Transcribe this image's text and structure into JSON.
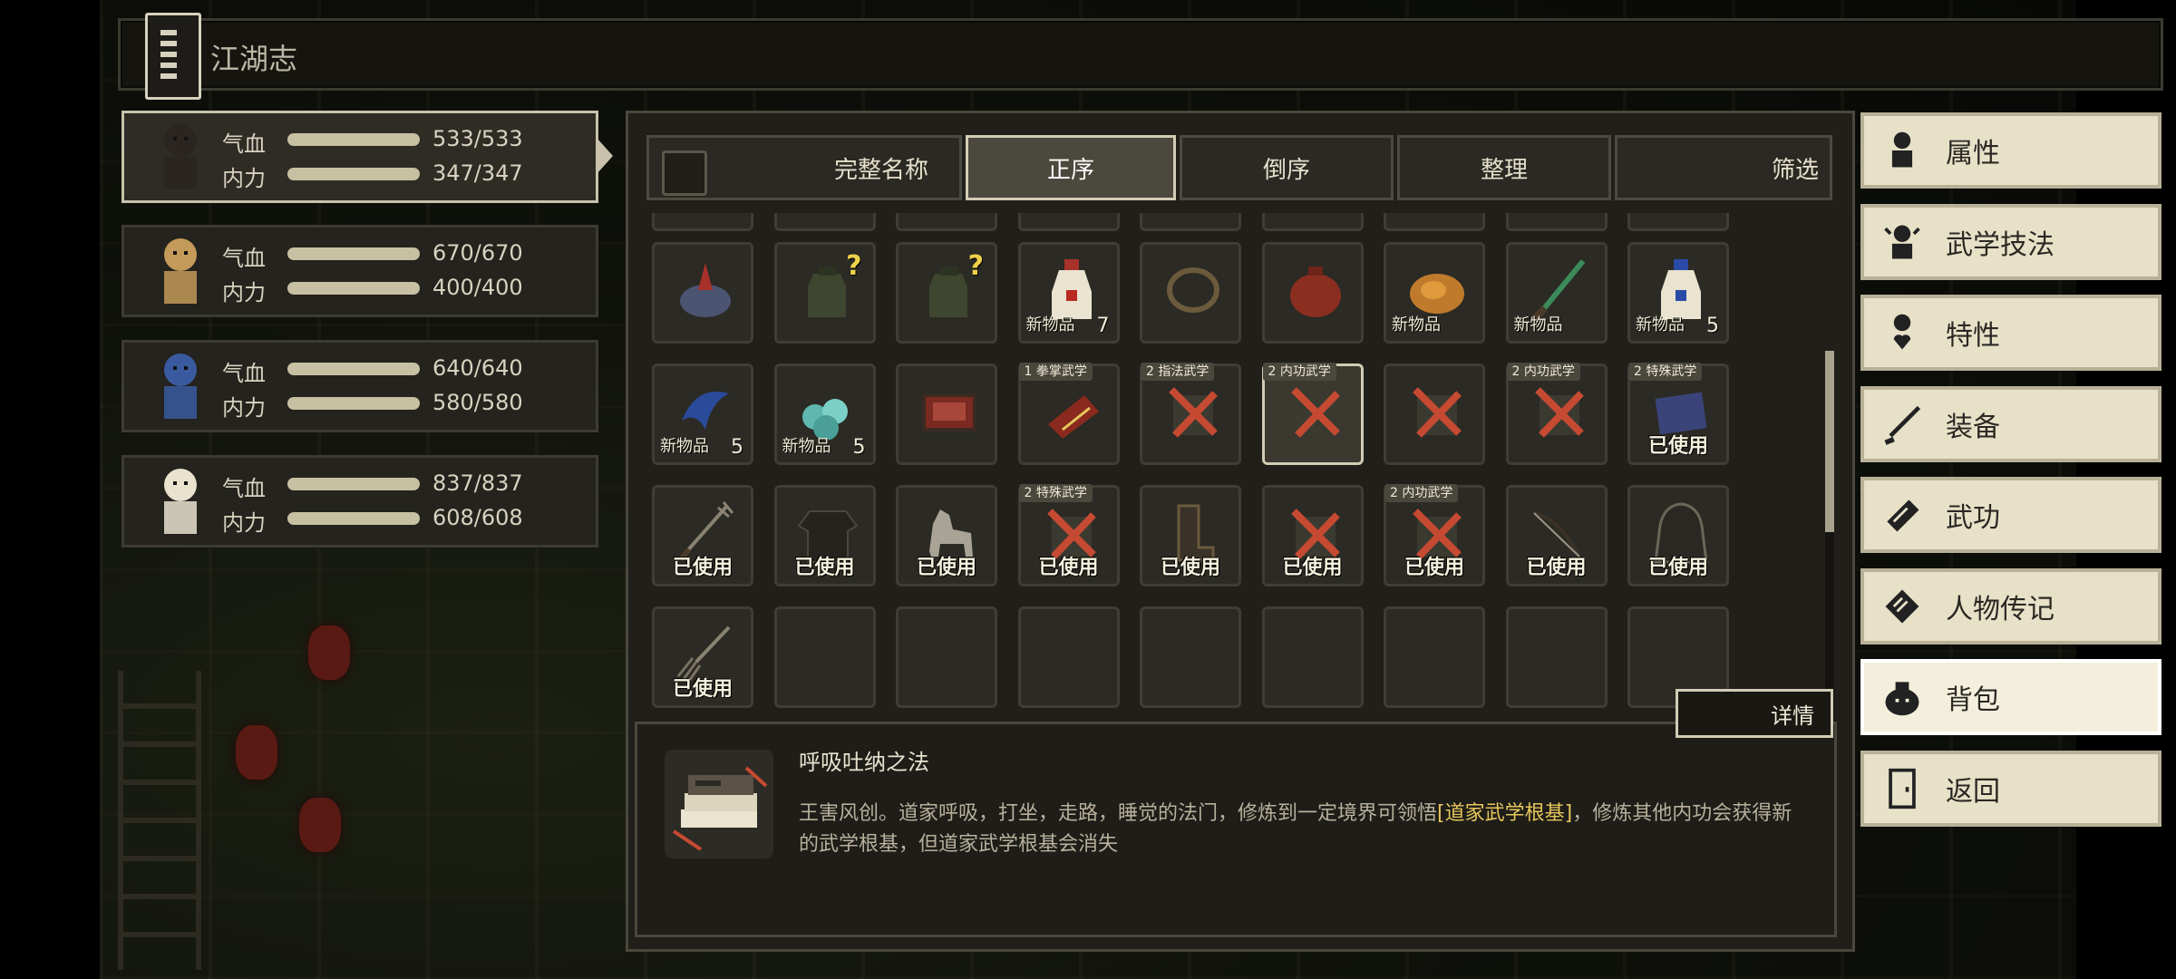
{
  "title": "江湖志",
  "party": [
    {
      "hp_label": "气血",
      "hp": "533/533",
      "mp_label": "内力",
      "mp": "347/347",
      "hp_fraction": 1,
      "mp_fraction": 1
    },
    {
      "hp_label": "气血",
      "hp": "670/670",
      "mp_label": "内力",
      "mp": "400/400",
      "hp_fraction": 1,
      "mp_fraction": 1
    },
    {
      "hp_label": "气血",
      "hp": "640/640",
      "mp_label": "内力",
      "mp": "580/580",
      "hp_fraction": 1,
      "mp_fraction": 1
    },
    {
      "hp_label": "气血",
      "hp": "837/837",
      "mp_label": "内力",
      "mp": "608/608",
      "hp_fraction": 1,
      "mp_fraction": 1
    }
  ],
  "toolbar": {
    "full_name": "完整名称",
    "ascending": "正序",
    "descending": "倒序",
    "organize": "整理",
    "filter": "筛选"
  },
  "rows": [
    [
      {
        "icon": "bird-cage-icon"
      },
      {
        "icon": "unknown-jar-icon",
        "badge": "?"
      },
      {
        "icon": "unknown-jar-icon",
        "badge": "?"
      },
      {
        "icon": "red-potion-icon",
        "foot": "新物品",
        "count": "7"
      },
      {
        "icon": "rope-icon"
      },
      {
        "icon": "red-pouch-icon"
      },
      {
        "icon": "roast-chicken-icon",
        "foot": "新物品"
      },
      {
        "icon": "green-sword-icon",
        "foot": "新物品"
      },
      {
        "icon": "blue-potion-icon",
        "foot": "新物品",
        "count": "5"
      }
    ],
    [
      {
        "icon": "blue-herb-icon",
        "foot": "新物品",
        "count": "5"
      },
      {
        "icon": "jade-stones-icon",
        "foot": "新物品",
        "count": "5"
      },
      {
        "icon": "red-rug-icon"
      },
      {
        "icon": "manual-book-icon",
        "tag": "1 拳掌武学"
      },
      {
        "icon": "crossed-manual-icon",
        "tag": "2 指法武学"
      },
      {
        "icon": "crossed-manual-icon",
        "tag": "2 内功武学",
        "selected": true
      },
      {
        "icon": "crossed-manual-icon"
      },
      {
        "icon": "crossed-manual-icon",
        "tag": "2 内功武学"
      },
      {
        "icon": "blue-scroll-icon",
        "tag": "2 特殊武学",
        "used": "已使用"
      }
    ],
    [
      {
        "icon": "fork-spear-icon",
        "used": "已使用"
      },
      {
        "icon": "black-robe-icon",
        "used": "已使用"
      },
      {
        "icon": "grey-horse-icon",
        "used": "已使用"
      },
      {
        "icon": "crossed-manual-icon",
        "tag": "2 特殊武学",
        "used": "已使用"
      },
      {
        "icon": "boots-icon",
        "used": "已使用"
      },
      {
        "icon": "crossed-manual-icon",
        "used": "已使用"
      },
      {
        "icon": "crossed-manual-icon",
        "tag": "2 内功武学",
        "used": "已使用"
      },
      {
        "icon": "bow-icon",
        "used": "已使用"
      },
      {
        "icon": "hooded-cloak-icon",
        "used": "已使用"
      }
    ],
    [
      {
        "icon": "broom-spear-icon",
        "used": "已使用"
      },
      {},
      {},
      {},
      {},
      {},
      {},
      {},
      {}
    ]
  ],
  "detail_button": "详情",
  "item": {
    "name": "呼吸吐纳之法",
    "desc_part1": "王害风创。道家呼吸，打坐，走路，睡觉的法门，修炼到一定境界可领悟",
    "desc_highlight": "[道家武学根基]",
    "desc_part2": "，修炼其他内功会获得新的武学根基，但道家武学根基会消失"
  },
  "menu": [
    {
      "label": "属性",
      "icon": "person-icon"
    },
    {
      "label": "武学技法",
      "icon": "skill-person-icon"
    },
    {
      "label": "特性",
      "icon": "trait-heart-icon"
    },
    {
      "label": "装备",
      "icon": "sword-icon"
    },
    {
      "label": "武功",
      "icon": "book-icon"
    },
    {
      "label": "人物传记",
      "icon": "scroll-icon"
    },
    {
      "label": "背包",
      "icon": "bag-icon",
      "active": true
    },
    {
      "label": "返回",
      "icon": "door-icon"
    }
  ],
  "colors": {
    "accent_gold": "#e6c75c",
    "panel": "#201f1a",
    "menu_bg": "#e7e1c8"
  }
}
